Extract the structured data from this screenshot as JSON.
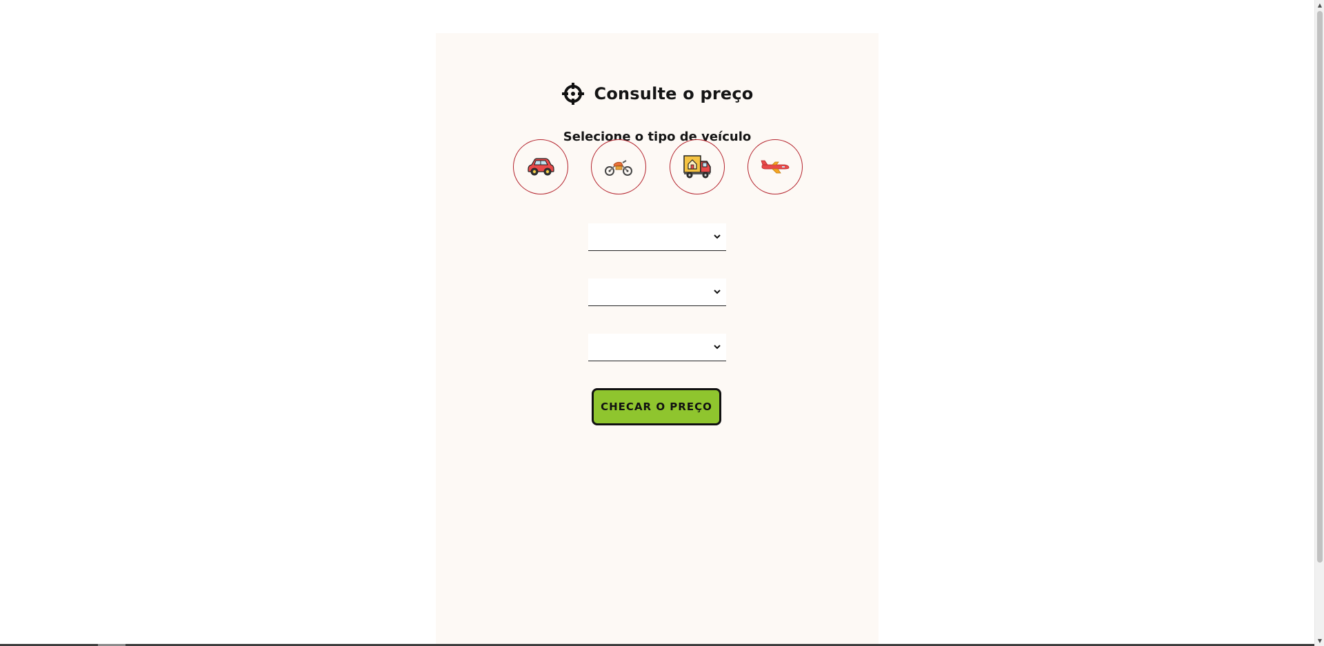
{
  "header": {
    "title": "Consulte o preço",
    "title_icon": "crosshair-icon"
  },
  "vehicle_section": {
    "subtitle": "Selecione o tipo de veículo",
    "vehicles": [
      {
        "icon": "car-icon"
      },
      {
        "icon": "motorcycle-icon"
      },
      {
        "icon": "truck-icon"
      },
      {
        "icon": "airplane-icon"
      }
    ]
  },
  "form": {
    "select_1": {
      "value": ""
    },
    "select_2": {
      "value": ""
    },
    "select_3": {
      "value": ""
    },
    "submit_label": "CHECAR O PREÇO"
  },
  "colors": {
    "panel_background": "#fdf9f5",
    "circle_border": "#b3202a",
    "button_background": "#8fc52e",
    "button_border": "#111111"
  }
}
